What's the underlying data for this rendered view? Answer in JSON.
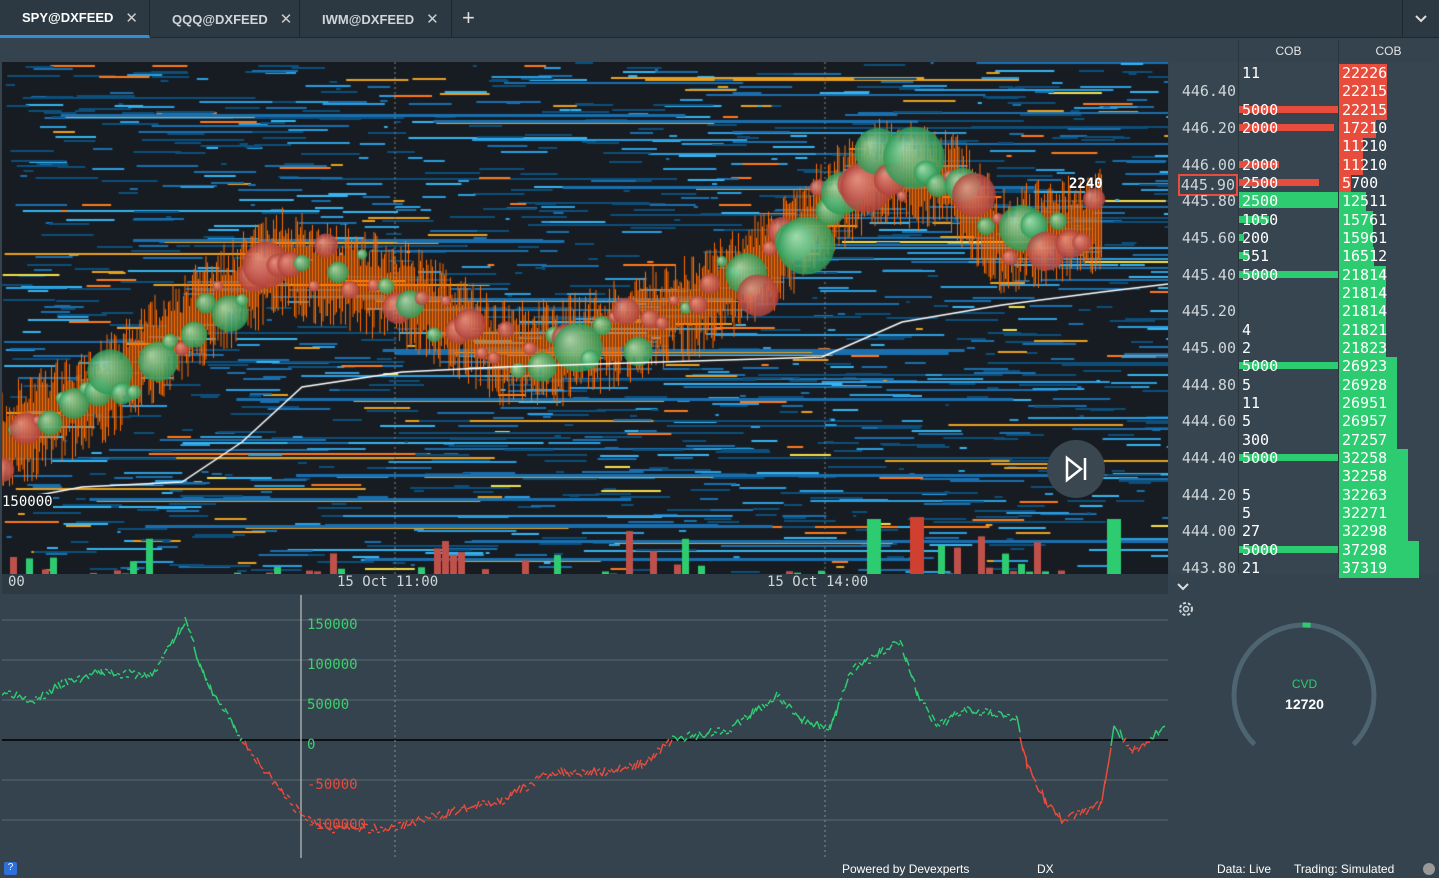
{
  "tabs": [
    {
      "label": "SPY@DXFEED",
      "active": true
    },
    {
      "label": "QQQ@DXFEED"
    },
    {
      "label": "IWM@DXFEED"
    }
  ],
  "tab_close": "✕",
  "add_tab": "+",
  "tab_menu": "⌄",
  "cob_headers": [
    "COB",
    "COB"
  ],
  "price_labels": [
    {
      "row": 1,
      "price": "446.40"
    },
    {
      "row": 3,
      "price": "446.20"
    },
    {
      "row": 5,
      "price": "446.00"
    },
    {
      "row": 6,
      "price": "445.90",
      "current": true
    },
    {
      "row": 7,
      "price": "445.80"
    },
    {
      "row": 9,
      "price": "445.60"
    },
    {
      "row": 11,
      "price": "445.40"
    },
    {
      "row": 13,
      "price": "445.20"
    },
    {
      "row": 15,
      "price": "445.00"
    },
    {
      "row": 17,
      "price": "444.80"
    },
    {
      "row": 19,
      "price": "444.60"
    },
    {
      "row": 21,
      "price": "444.40"
    },
    {
      "row": 23,
      "price": "444.20"
    },
    {
      "row": 25,
      "price": "444.00"
    },
    {
      "row": 27,
      "price": "443.80"
    }
  ],
  "cob1": [
    "11",
    "",
    "5000",
    "2000",
    "",
    "2000",
    "2500",
    "2500",
    "1050",
    "200",
    "551",
    "5000",
    "",
    "",
    "4",
    "2",
    "5000",
    "5",
    "11",
    "5",
    "300",
    "5000",
    "",
    "5",
    "5",
    "27",
    "5000",
    "21"
  ],
  "cob2": [
    "22226",
    "22215",
    "22215",
    "17210",
    "11210",
    "11210",
    "5700",
    "12511",
    "15761",
    "15961",
    "16512",
    "21814",
    "21814",
    "21814",
    "21821",
    "21823",
    "26923",
    "26928",
    "26951",
    "26957",
    "27257",
    "32258",
    "32258",
    "32263",
    "32271",
    "32298",
    "37298",
    "37319"
  ],
  "ask_rows": 7,
  "heatmap": {
    "last_size_label": "2240",
    "left_label": "150000",
    "x_labels": [
      "00",
      "15 Oct 11:00",
      "15 Oct 14:00"
    ]
  },
  "cvd": {
    "title": "CVD",
    "value": "12720",
    "gauge_fraction": 0.52,
    "y_labels": [
      "150000",
      "100000",
      "50000",
      "0",
      "-50000",
      "-100000"
    ],
    "series": [
      [
        0,
        62000
      ],
      [
        35,
        50000
      ],
      [
        60,
        70000
      ],
      [
        100,
        85000
      ],
      [
        150,
        80000
      ],
      [
        183,
        150000
      ],
      [
        205,
        70000
      ],
      [
        240,
        0
      ],
      [
        270,
        -50000
      ],
      [
        300,
        -95000
      ],
      [
        330,
        -110000
      ],
      [
        390,
        -110000
      ],
      [
        450,
        -90000
      ],
      [
        500,
        -75000
      ],
      [
        550,
        -40000
      ],
      [
        600,
        -40000
      ],
      [
        640,
        -30000
      ],
      [
        670,
        0
      ],
      [
        730,
        15000
      ],
      [
        775,
        55000
      ],
      [
        800,
        25000
      ],
      [
        828,
        15000
      ],
      [
        848,
        85000
      ],
      [
        898,
        125000
      ],
      [
        915,
        60000
      ],
      [
        935,
        15000
      ],
      [
        962,
        40000
      ],
      [
        990,
        35000
      ],
      [
        1015,
        25000
      ],
      [
        1025,
        -30000
      ],
      [
        1045,
        -80000
      ],
      [
        1060,
        -100000
      ],
      [
        1100,
        -80000
      ],
      [
        1112,
        20000
      ],
      [
        1130,
        -15000
      ],
      [
        1163,
        15000
      ]
    ]
  },
  "status": {
    "powered": "Powered by Devexperts",
    "dx": "DX",
    "data": "Data: Live",
    "trading": "Trading: Simulated"
  },
  "colors": {
    "bid": "#2ecc71",
    "ask": "#e74c3c",
    "accent": "#2f8fd8"
  }
}
